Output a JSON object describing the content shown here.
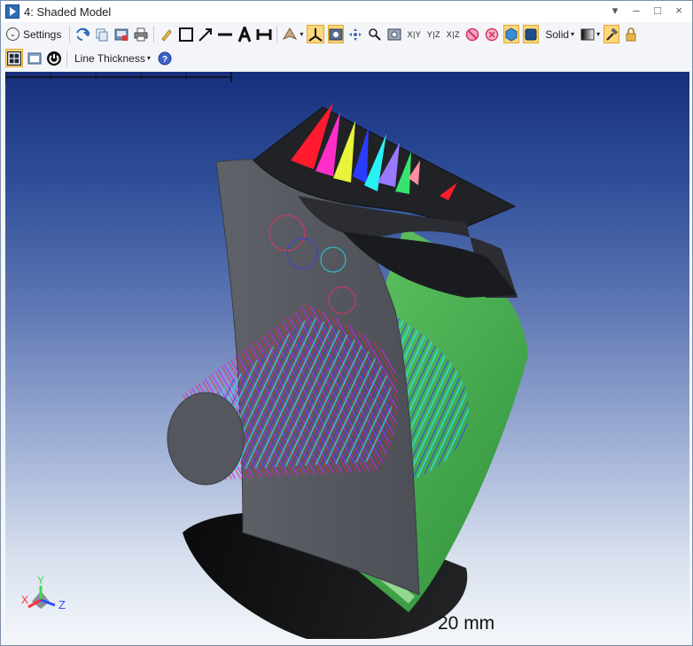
{
  "window": {
    "title": "4: Shaded Model",
    "controls": [
      "▾",
      "–",
      "□",
      "×"
    ]
  },
  "toolbar1": {
    "settings_label": "Settings",
    "axis_xy": "X|Y",
    "axis_yz": "Y|Z",
    "axis_xz": "X|Z",
    "render_mode": "Solid",
    "colors": {
      "accent": "#fbd67a",
      "accent_border": "#e2a92e",
      "icon_blue": "#2d6db5"
    }
  },
  "toolbar2": {
    "line_thickness_label": "Line Thickness"
  },
  "viewport": {
    "scale_label": "20 mm",
    "axis_x": "X",
    "axis_y": "Y",
    "axis_z": "Z",
    "colors": {
      "bg_top": "#172f7c",
      "bg_bottom": "#f3f6fa",
      "surface": "#55575f",
      "mirror_green": "#41a84a",
      "ray_red": "#ff1a2e",
      "ray_blue": "#2a3cff",
      "ray_cyan": "#20e8f0"
    }
  }
}
